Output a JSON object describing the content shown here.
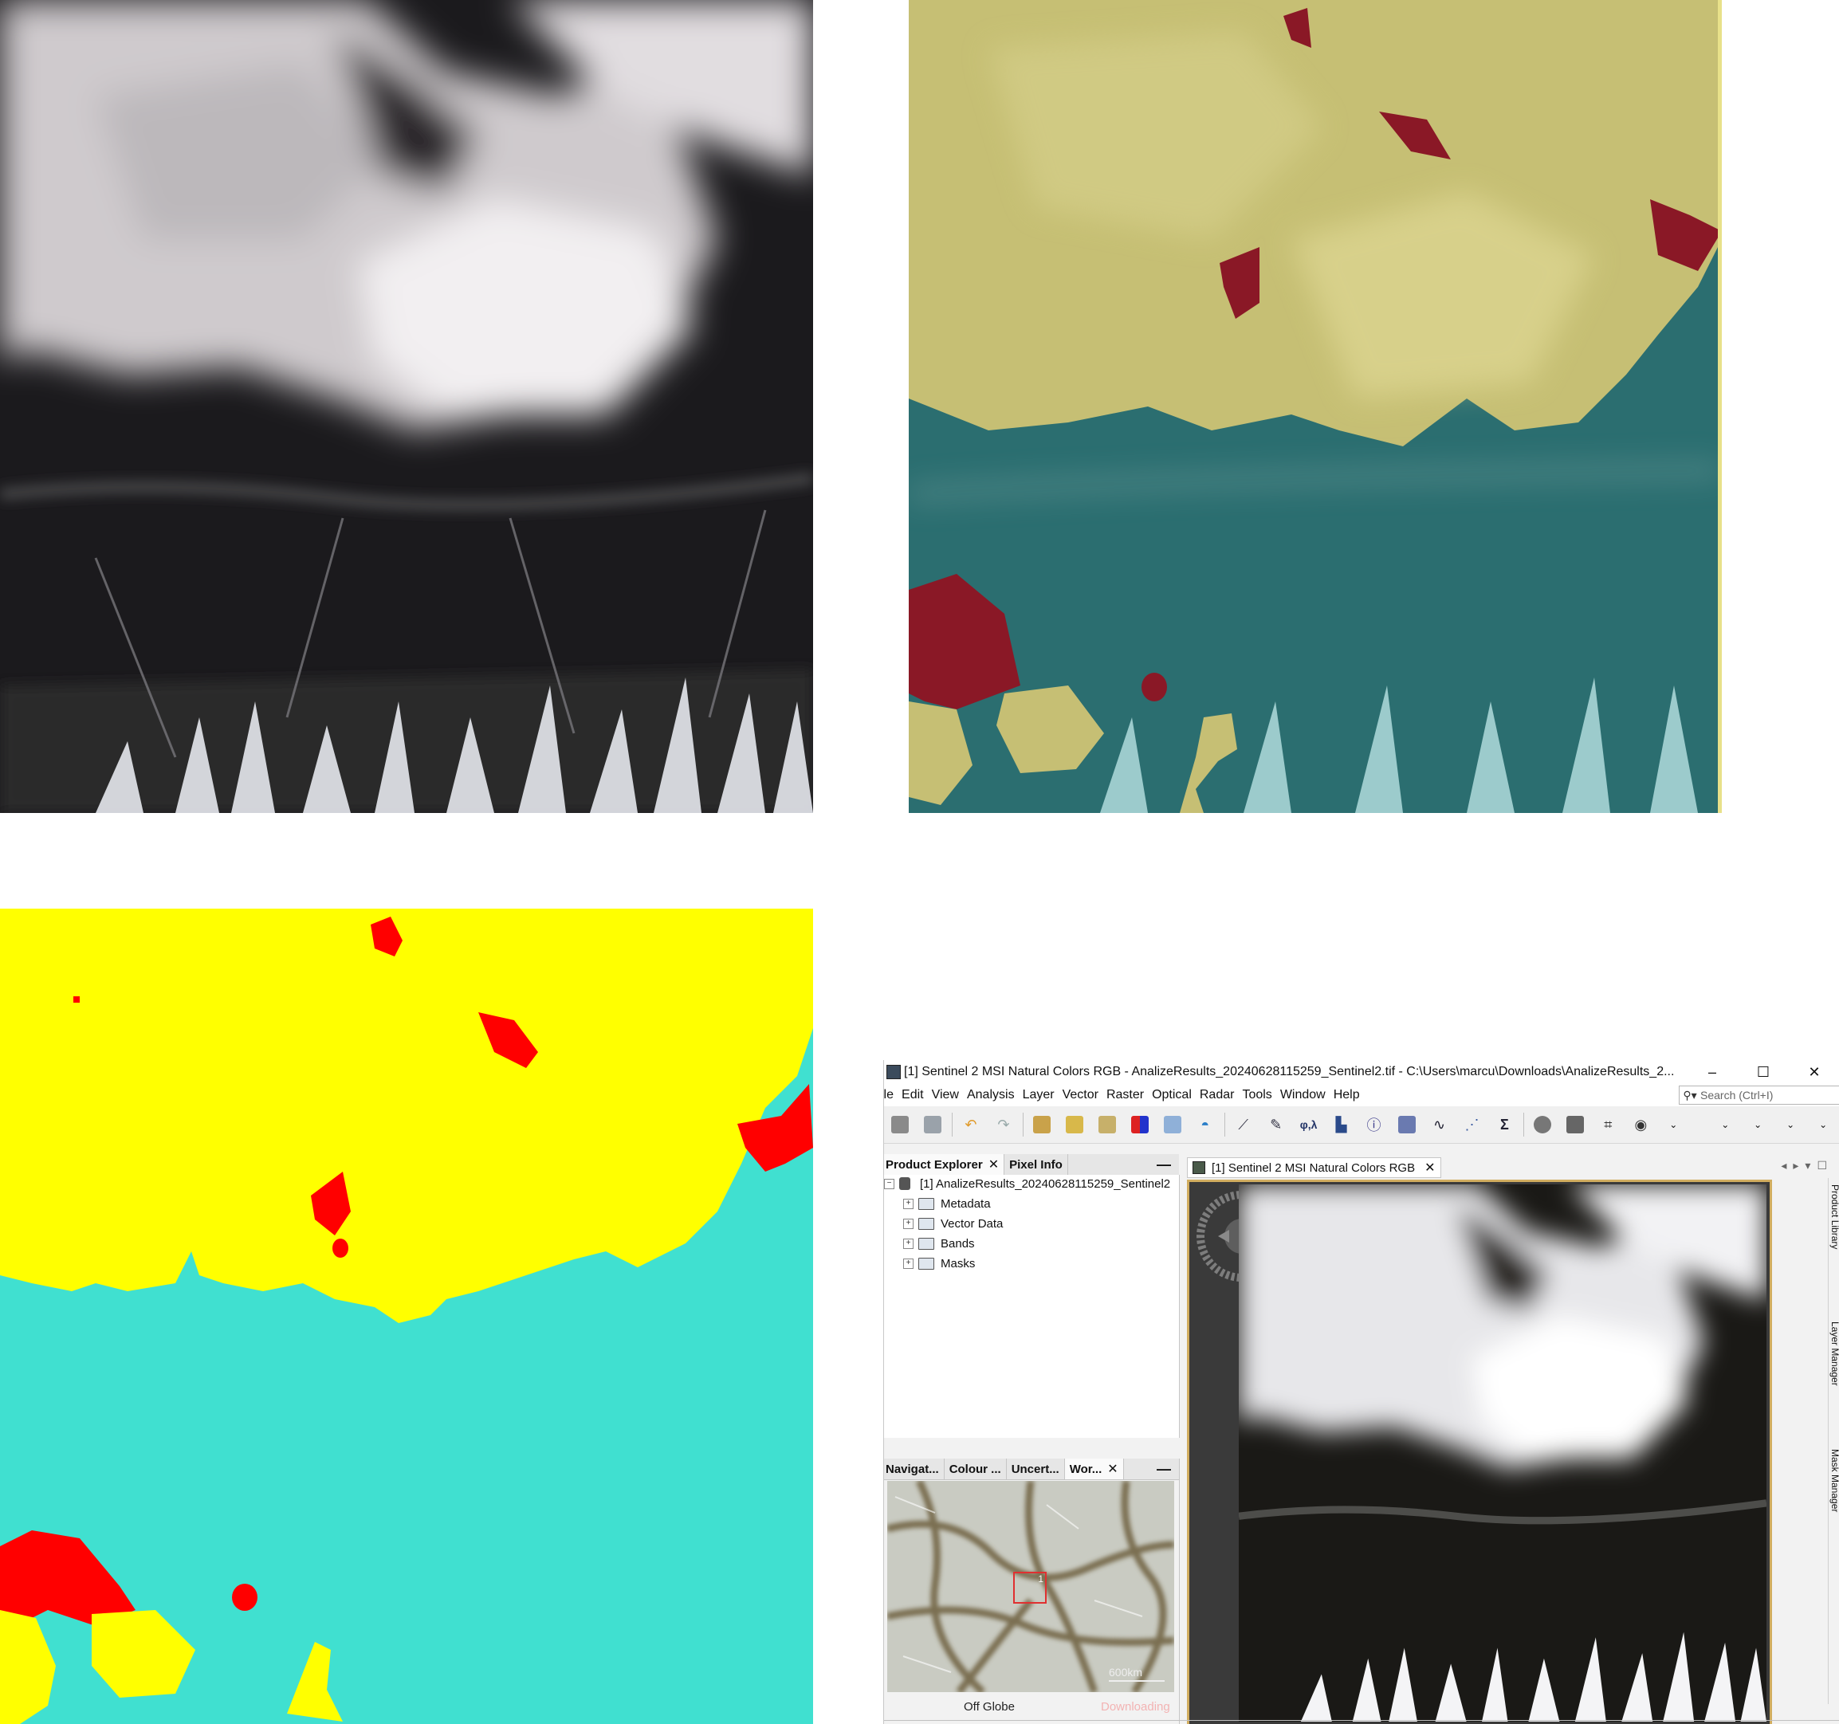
{
  "window": {
    "title": "[1] Sentinel 2 MSI Natural Colors RGB - AnalizeResults_20240628115259_Sentinel2.tif - C:\\Users\\marcu\\Downloads\\AnalizeResults_2...",
    "minimize": "–",
    "maximize": "☐",
    "close": "✕"
  },
  "menu": [
    "ile",
    "Edit",
    "View",
    "Analysis",
    "Layer",
    "Vector",
    "Raster",
    "Optical",
    "Radar",
    "Tools",
    "Window",
    "Help"
  ],
  "search": {
    "placeholder": "Search (Ctrl+I)"
  },
  "toolbar": {
    "icons": [
      "open-product-icon",
      "session-icon",
      "undo-icon",
      "redo-icon",
      "tool-icon-1",
      "tool-icon-2",
      "tool-icon-3",
      "rgb-icon",
      "band-maths-icon",
      "wave-icon",
      "polyline-icon",
      "draw-icon",
      "phi-lambda-icon",
      "histogram-icon",
      "info-icon",
      "time-series-icon",
      "spectrum-icon",
      "scatter-icon",
      "sigma-icon",
      "mask-icon",
      "pin-icon",
      "grid-icon",
      "eye-icon"
    ],
    "phi_label": "φ,λ",
    "sigma_label": "Σ"
  },
  "left_tabs": [
    {
      "label": "Product Explorer",
      "active": true
    },
    {
      "label": "Pixel Info",
      "active": false
    }
  ],
  "explorer": {
    "product": "[1]  AnalizeResults_20240628115259_Sentinel2",
    "nodes": [
      "Metadata",
      "Vector Data",
      "Bands",
      "Masks"
    ]
  },
  "nav_tabs": [
    "Navigat...",
    "Colour ...",
    "Uncert...",
    "Wor..."
  ],
  "nav": {
    "scale": "600km",
    "marker": "1",
    "status_left": "Off Globe",
    "status_right": "Downloading"
  },
  "view_tab": {
    "label": "[1] Sentinel 2 MSI Natural Colors RGB"
  },
  "right_sidebar": [
    "Product Library",
    "Layer Manager",
    "Mask Manager"
  ],
  "colors": {
    "cloud_class": "#ffff00",
    "clear_class": "#40e0d0",
    "shadow_class": "#ff0000",
    "view_border": "#d1ad5f",
    "overlay_cloud": "#c9c27a",
    "overlay_clear": "#2a6f6f",
    "overlay_shadow": "#8a1826"
  }
}
